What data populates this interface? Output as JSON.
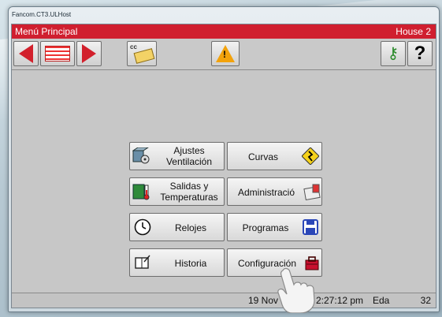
{
  "window": {
    "title": "Fancom.CT3.ULHost"
  },
  "header": {
    "title": "Menú Principal",
    "location": "House 2"
  },
  "toolbar": {
    "buttons": [
      {
        "icon": "left-arrow-icon"
      },
      {
        "icon": "list-icon"
      },
      {
        "icon": "right-arrow-icon"
      },
      {
        "icon": "cc-money-icon",
        "label": "cc"
      },
      {
        "icon": "warning-icon",
        "label": "!"
      },
      {
        "icon": "keys-icon"
      },
      {
        "icon": "help-icon",
        "label": "?"
      }
    ]
  },
  "menu": {
    "ajustes": {
      "label": "Ajustes Ventilación",
      "icon": "ventilation-icon"
    },
    "curvas": {
      "label": "Curvas",
      "icon": "curve-sign-icon"
    },
    "salidas": {
      "label": "Salidas y Temperaturas",
      "icon": "thermometer-icon"
    },
    "administracion": {
      "label": "Administració",
      "icon": "admin-icon"
    },
    "relojes": {
      "label": "Relojes",
      "icon": "clock-icon"
    },
    "programas": {
      "label": "Programas",
      "icon": "floppy-icon"
    },
    "historia": {
      "label": "Historia",
      "icon": "book-icon"
    },
    "configuracion": {
      "label": "Configuración",
      "icon": "toolbox-icon"
    }
  },
  "status": {
    "date": "19 Nov 2",
    "time": "2:27:12 pm",
    "user": "Eda",
    "number": "32"
  },
  "colors": {
    "header": "#d01f2f",
    "arrows": "#d2202c",
    "panel": "#c7c7c7"
  }
}
